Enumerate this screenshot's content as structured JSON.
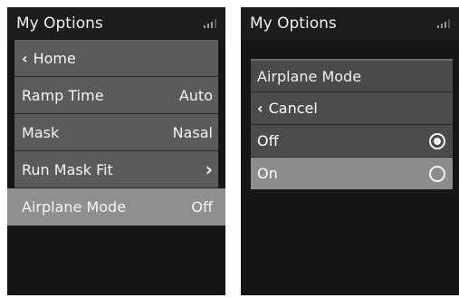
{
  "left_screen": {
    "title": "My Options",
    "items": [
      {
        "label": "Home",
        "value": ""
      },
      {
        "label": "Ramp Time",
        "value": "Auto"
      },
      {
        "label": "Mask",
        "value": "Nasal"
      },
      {
        "label": "Run Mask Fit",
        "value": "›"
      },
      {
        "label": "Airplane Mode",
        "value": "Off"
      }
    ],
    "selected_index": 4
  },
  "right_screen": {
    "title": "My Options",
    "dialog": {
      "title": "Airplane Mode",
      "cancel_label": "Cancel",
      "options": [
        {
          "label": "Off",
          "checked": true
        },
        {
          "label": "On",
          "checked": false
        }
      ],
      "selected_index": 1
    }
  },
  "icons": {
    "signal": "signal-strength-icon",
    "back": "chevron-left-icon",
    "forward": "chevron-right-icon",
    "radio": "radio-button-icon"
  },
  "colors": {
    "screen_bg": "#161616",
    "row_bg": "#5b5b5b",
    "selected_bg": "#8f8f8f"
  }
}
